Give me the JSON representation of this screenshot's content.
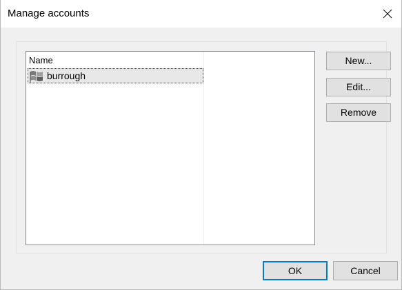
{
  "window": {
    "title": "Manage accounts",
    "close_icon": "close-icon"
  },
  "accounts_list": {
    "column_header": "Name",
    "items": [
      {
        "label": "burrough",
        "icon": "windows-flag-icon",
        "selected": true
      }
    ]
  },
  "side_buttons": {
    "new_label": "New...",
    "edit_label": "Edit...",
    "remove_label": "Remove"
  },
  "footer": {
    "ok_label": "OK",
    "cancel_label": "Cancel"
  },
  "colors": {
    "dialog_background": "#f0f0f0",
    "titlebar_background": "#ffffff",
    "default_button_border": "#0078d7",
    "selection_background": "#e8e8e8"
  }
}
